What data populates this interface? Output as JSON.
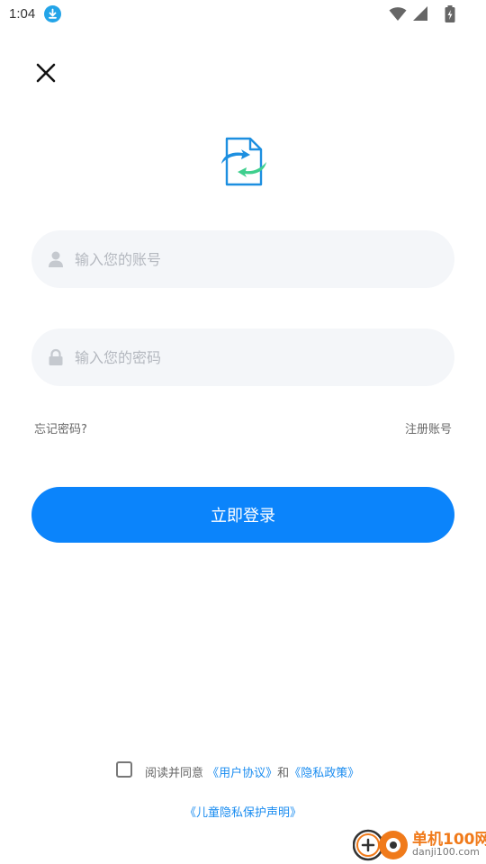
{
  "status_bar": {
    "time": "1:04"
  },
  "login": {
    "account_placeholder": "输入您的账号",
    "password_placeholder": "输入您的密码",
    "forgot_password": "忘记密码?",
    "register": "注册账号",
    "login_button": "立即登录"
  },
  "agreement": {
    "prefix": "阅读并同意",
    "user_agreement": "《用户协议》",
    "conjunction": "和",
    "privacy_policy": "《隐私政策》",
    "child_privacy": "《儿童隐私保护声明》"
  },
  "watermark": {
    "name": "单机100网",
    "domain": "danji100.com"
  },
  "colors": {
    "primary": "#0b84fb",
    "link": "#1a8cf0",
    "field_bg": "#f4f6f9",
    "logo_blue": "#1d8fe0",
    "logo_green": "#3fcf8e"
  },
  "icons": {
    "download": "download-icon",
    "wifi": "wifi-icon",
    "signal": "signal-icon",
    "battery": "battery-icon",
    "close": "close-icon",
    "logo": "document-sync-logo",
    "user": "user-icon",
    "lock": "lock-icon"
  }
}
